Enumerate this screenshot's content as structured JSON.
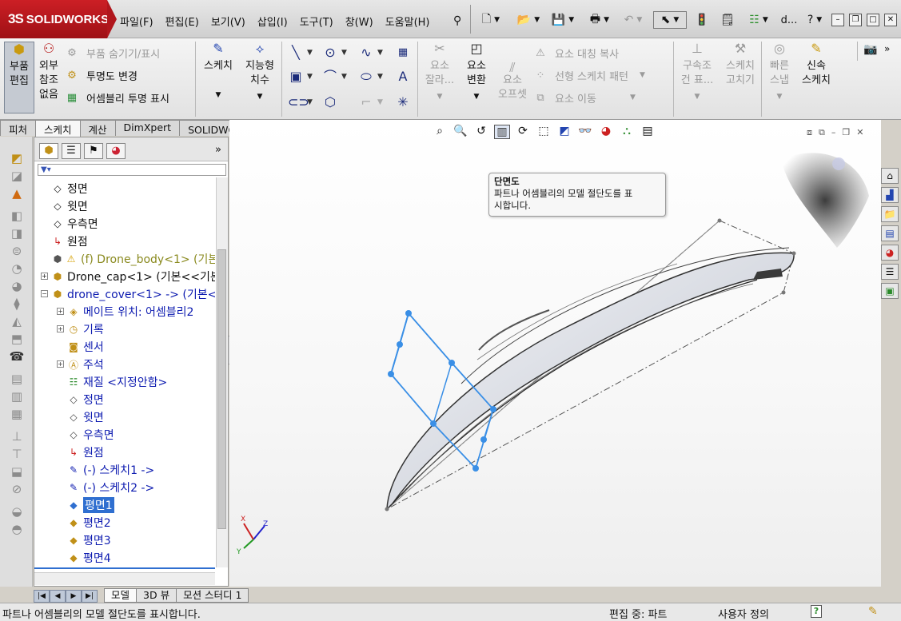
{
  "app": {
    "logo_text": "SOLIDWORKS",
    "logo_mark": "3S"
  },
  "menu": {
    "items": [
      "파일(F)",
      "편집(E)",
      "보기(V)",
      "삽입(I)",
      "도구(T)",
      "창(W)",
      "도움말(H)"
    ],
    "user_short": "d...",
    "help": "?"
  },
  "command_manager": {
    "edit_part": "부품\n편집",
    "external_refs": "외부\n참조\n없음",
    "hide_show_parts": "부품 숨기기/표시",
    "change_transparency": "투명도 변경",
    "assembly_transparency": "어셈블리 투명 표시",
    "sketch": "스케치",
    "smart_dimension": "지능형\n치수",
    "trim_entities": "요소\n잘라...",
    "convert_entities": "요소\n변환",
    "offset_entities": "요소\n오프셋",
    "mirror_entities": "요소 대칭 복사",
    "linear_pattern": "선형 스케치 패턴",
    "move_entities": "요소 이동",
    "display_relations": "구속조\n건 표...",
    "repair_sketch": "스케치\n고치기",
    "quick_snaps": "빠른\n스냅",
    "rapid_sketch": "신속\n스케치"
  },
  "tabs": [
    "피처",
    "스케치",
    "계산",
    "DimXpert",
    "SOLIDWORKS 애드인"
  ],
  "active_tab": "스케치",
  "tree": {
    "rows": [
      {
        "label": "정면",
        "icon": "plane-icon"
      },
      {
        "label": "윗면",
        "icon": "plane-icon"
      },
      {
        "label": "우측면",
        "icon": "plane-icon"
      },
      {
        "label": "원점",
        "icon": "origin-icon"
      },
      {
        "label": "(f) Drone_body<1> (기본<",
        "icon": "part-warning-icon"
      },
      {
        "label": "Drone_cap<1> (기본<<기본",
        "icon": "part-icon"
      },
      {
        "label": "drone_cover<1> -> (기본<",
        "icon": "part-icon"
      },
      {
        "label": "메이트 위치: 어셈블리2",
        "icon": "mate-icon"
      },
      {
        "label": "기록",
        "icon": "history-icon"
      },
      {
        "label": "센서",
        "icon": "sensor-icon"
      },
      {
        "label": "주석",
        "icon": "annotation-icon"
      },
      {
        "label": "재질 <지정안함>",
        "icon": "material-icon"
      },
      {
        "label": "정면",
        "icon": "plane-icon"
      },
      {
        "label": "윗면",
        "icon": "plane-icon"
      },
      {
        "label": "우측면",
        "icon": "plane-icon"
      },
      {
        "label": "원점",
        "icon": "origin-icon"
      },
      {
        "label": "(-) 스케치1 ->",
        "icon": "sketch-icon"
      },
      {
        "label": "(-) 스케치2 ->",
        "icon": "sketch-icon"
      },
      {
        "label": "평면1",
        "icon": "plane-icon"
      },
      {
        "label": "평면2",
        "icon": "plane-icon"
      },
      {
        "label": "평면3",
        "icon": "plane-icon"
      },
      {
        "label": "평면4",
        "icon": "plane-icon"
      }
    ]
  },
  "bottom_tabs": [
    "모델",
    "3D 뷰",
    "모션 스터디 1"
  ],
  "tooltip": {
    "title": "단면도",
    "body_line1": "파트나 어셈블리의 모델 절단도를 표",
    "body_line2": "시합니다."
  },
  "status": {
    "message": "파트나 어셈블리의 모델 절단도를 표시합니다.",
    "mode": "편집 중: 파트",
    "units": "사용자 정의"
  },
  "triad": {
    "x": "X",
    "y": "Y",
    "z": "Z"
  },
  "colors": {
    "logo_red": "#c41a20",
    "tree_blue": "#0d1bb0",
    "selection_blue": "#2f6fd0",
    "sketch_line_blue": "#3a8fe6"
  }
}
